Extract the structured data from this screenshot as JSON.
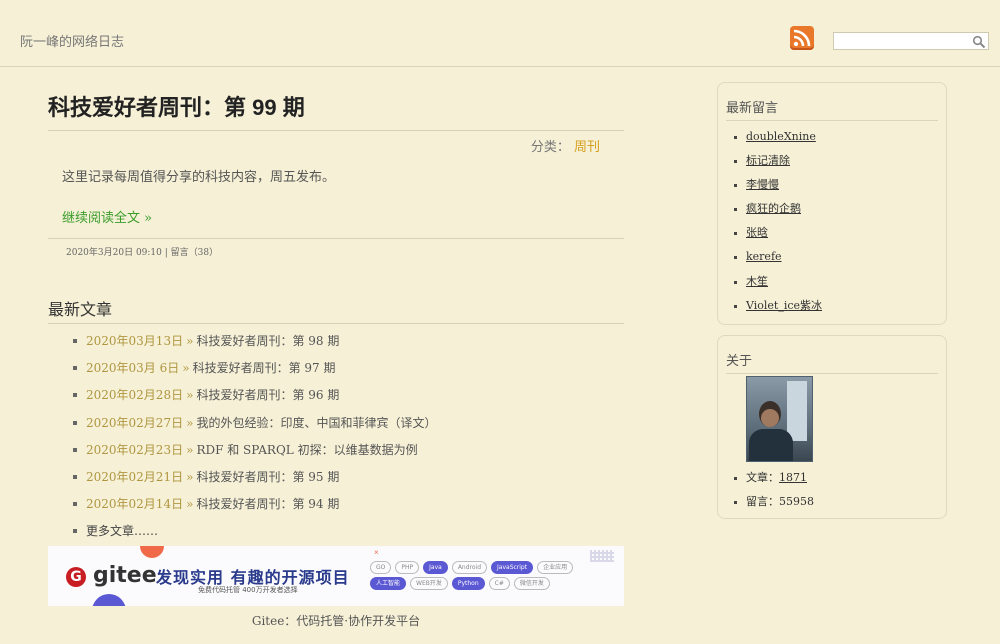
{
  "header": {
    "site_title": "阮一峰的网络日志",
    "search_placeholder": ""
  },
  "post": {
    "title": "科技爱好者周刊：第 99 期",
    "category_label": "分类：",
    "category": "周刊",
    "summary": "这里记录每周值得分享的科技内容，周五发布。",
    "read_more": "继续阅读全文 »",
    "meta": "2020年3月20日 09:10 | 留言（38）"
  },
  "recent": {
    "title": "最新文章",
    "items": [
      {
        "date": "2020年03月13日",
        "title": "科技爱好者周刊：第 98 期"
      },
      {
        "date": "2020年03月 6日",
        "title": "科技爱好者周刊：第 97 期"
      },
      {
        "date": "2020年02月28日",
        "title": "科技爱好者周刊：第 96 期"
      },
      {
        "date": "2020年02月27日",
        "title": "我的外包经验：印度、中国和菲律宾（译文）"
      },
      {
        "date": "2020年02月23日",
        "title": "RDF 和 SPARQL 初探：以维基数据为例"
      },
      {
        "date": "2020年02月21日",
        "title": "科技爱好者周刊：第 95 期"
      },
      {
        "date": "2020年02月14日",
        "title": "科技爱好者周刊：第 94 期"
      }
    ],
    "separator": "»",
    "more": "更多文章……"
  },
  "banner": {
    "logo_letter": "G",
    "logo_text": "gitee",
    "slogan": "发现实用 有趣的开源项目",
    "subline": "免费代码托管    400万开发者选择",
    "close_mark": "×",
    "tags": [
      {
        "label": "GO",
        "hot": false
      },
      {
        "label": "PHP",
        "hot": false
      },
      {
        "label": "Java",
        "hot": true
      },
      {
        "label": "Android",
        "hot": false
      },
      {
        "label": "JavaScript",
        "hot": true
      },
      {
        "label": "企业应用",
        "hot": false
      },
      {
        "label": "人工智能",
        "hot": true
      },
      {
        "label": "WEB开发",
        "hot": false
      },
      {
        "label": "Python",
        "hot": true
      },
      {
        "label": "C#",
        "hot": false
      },
      {
        "label": "微信开发",
        "hot": false
      }
    ],
    "caption": "Gitee：代码托管·协作开发平台"
  },
  "sidebar": {
    "comments_title": "最新留言",
    "comments": [
      "doubleXnine",
      "标记清除",
      "李慢慢",
      "疯狂的企鹅",
      "张晗",
      "kerefe",
      "木笙",
      "Violet_ice紫冰"
    ],
    "about_title": "关于",
    "about": {
      "posts_label": "文章：",
      "posts": "1871",
      "comments_label": "留言：",
      "comments": "55958"
    }
  },
  "colors": {
    "background": "#f5f0d6",
    "category": "#d6a01e",
    "read_more": "#3a9d2a",
    "date": "#b09640",
    "rss": "#e9782a"
  }
}
